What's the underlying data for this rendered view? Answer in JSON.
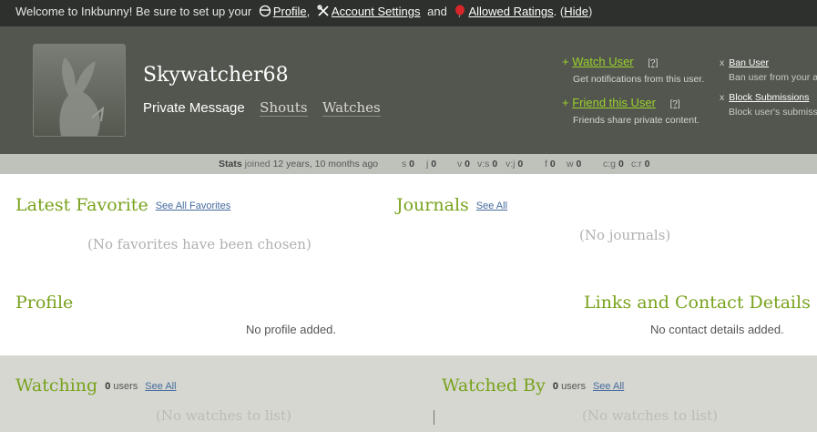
{
  "welcome": {
    "intro": "Welcome to Inkbunny! Be sure to set up your",
    "profile": "Profile",
    "comma": ",",
    "account_settings": "Account Settings",
    "and": "and",
    "allowed_ratings": "Allowed Ratings",
    "dot_open": ". (",
    "hide": "Hide",
    "close_paren": ")"
  },
  "user": {
    "name": "Skywatcher68",
    "tabs": [
      "Private Message",
      "Shouts",
      "Watches"
    ]
  },
  "actions": {
    "plus": "+",
    "q": "[?]",
    "watch": {
      "label": "Watch User",
      "desc": "Get notifications from this user."
    },
    "friend": {
      "label": "Friend this User",
      "desc": "Friends share private content."
    },
    "x": "x",
    "ban": {
      "label": "Ban User",
      "desc": "Ban user from your a"
    },
    "block": {
      "label": "Block Submissions",
      "desc": "Block user's submiss"
    }
  },
  "stats": {
    "label": "Stats",
    "joined_word": "joined",
    "joined_value": "12 years, 10 months ago",
    "items": [
      {
        "k": "s",
        "v": "0"
      },
      {
        "k": "j",
        "v": "0"
      },
      {
        "k": "v",
        "v": "0"
      },
      {
        "k": "v:s",
        "v": "0"
      },
      {
        "k": "v:j",
        "v": "0"
      },
      {
        "k": "f",
        "v": "0"
      },
      {
        "k": "w",
        "v": "0"
      },
      {
        "k": "c:g",
        "v": "0"
      },
      {
        "k": "c:r",
        "v": "0"
      }
    ]
  },
  "sections": {
    "latest_favorite": {
      "title": "Latest Favorite",
      "link": "See All Favorites",
      "empty": "(No favorites have been chosen)"
    },
    "journals": {
      "title": "Journals",
      "link": "See All",
      "empty": "(No journals)"
    },
    "profile": {
      "title": "Profile",
      "empty": "No profile added."
    },
    "links": {
      "title": "Links and Contact Details",
      "empty": "No contact details added."
    },
    "watching": {
      "title": "Watching",
      "count": "0",
      "users": "users",
      "link": "See All",
      "empty": "(No watches to list)"
    },
    "watched_by": {
      "title": "Watched By",
      "count": "0",
      "users": "users",
      "link": "See All",
      "empty": "(No watches to list)"
    }
  },
  "colors": {
    "accent_green": "#78a21c",
    "link_blue": "#466b9e",
    "header_bg": "#53564f"
  }
}
